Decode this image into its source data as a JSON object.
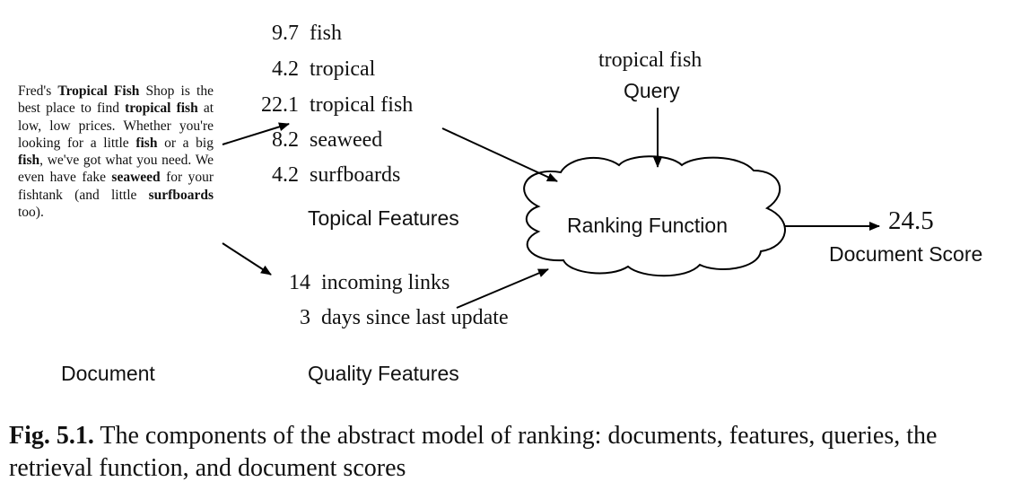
{
  "document": {
    "label": "Document",
    "text_parts": [
      {
        "t": "Fred's ",
        "b": false
      },
      {
        "t": "Tropical Fish",
        "b": true
      },
      {
        "t": " Shop is the best place to find ",
        "b": false
      },
      {
        "t": "tropical fish",
        "b": true
      },
      {
        "t": " at low, low prices. Whether you're looking for a little ",
        "b": false
      },
      {
        "t": "fish",
        "b": true
      },
      {
        "t": " or a big ",
        "b": false
      },
      {
        "t": "fish",
        "b": true
      },
      {
        "t": ", we've got what you need. We even have fake ",
        "b": false
      },
      {
        "t": "seaweed",
        "b": true
      },
      {
        "t": " for your fishtank (and little ",
        "b": false
      },
      {
        "t": "surfboards",
        "b": true
      },
      {
        "t": " too).",
        "b": false
      }
    ]
  },
  "topical_features": {
    "label": "Topical Features",
    "items": [
      {
        "value": "9.7",
        "term": "fish"
      },
      {
        "value": "4.2",
        "term": "tropical"
      },
      {
        "value": "22.1",
        "term": "tropical fish"
      },
      {
        "value": "8.2",
        "term": "seaweed"
      },
      {
        "value": "4.2",
        "term": "surfboards"
      }
    ]
  },
  "quality_features": {
    "label": "Quality Features",
    "items": [
      {
        "value": "14",
        "term": "incoming links"
      },
      {
        "value": "3",
        "term": "days since last update"
      }
    ]
  },
  "query": {
    "text": "tropical fish",
    "label": "Query"
  },
  "ranking_function": {
    "label": "Ranking Function"
  },
  "score": {
    "value": "24.5",
    "label": "Document Score"
  },
  "caption": {
    "prefix": "Fig. 5.1.",
    "text": " The components of the abstract model of ranking: documents, features, queries, the retrieval function, and document scores"
  }
}
